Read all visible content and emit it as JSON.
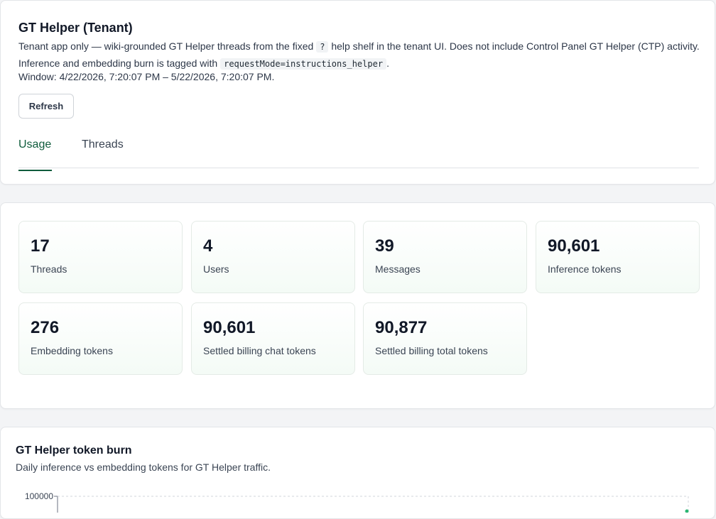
{
  "header": {
    "title": "GT Helper (Tenant)",
    "desc_part1": "Tenant app only — wiki-grounded GT Helper threads from the fixed",
    "desc_code1": "?",
    "desc_part2": "help shelf in the tenant UI. Does not include Control Panel GT Helper (CTP) activity. Inference and embedding burn is tagged with",
    "desc_code2": "requestMode=instructions_helper",
    "desc_part3": ".",
    "window": "Window: 4/22/2026, 7:20:07 PM – 5/22/2026, 7:20:07 PM.",
    "refresh_label": "Refresh"
  },
  "tabs": [
    {
      "label": "Usage",
      "active": true
    },
    {
      "label": "Threads",
      "active": false
    }
  ],
  "stats": [
    {
      "value": "17",
      "label": "Threads"
    },
    {
      "value": "4",
      "label": "Users"
    },
    {
      "value": "39",
      "label": "Messages"
    },
    {
      "value": "90,601",
      "label": "Inference tokens"
    },
    {
      "value": "276",
      "label": "Embedding tokens"
    },
    {
      "value": "90,601",
      "label": "Settled billing chat tokens"
    },
    {
      "value": "90,877",
      "label": "Settled billing total tokens"
    }
  ],
  "chart": {
    "title": "GT Helper token burn",
    "subtitle": "Daily inference vs embedding tokens for GT Helper traffic.",
    "y_tick_top": "100000",
    "accent_color": "#0f5c3c",
    "series_color": "#2bb673"
  }
}
